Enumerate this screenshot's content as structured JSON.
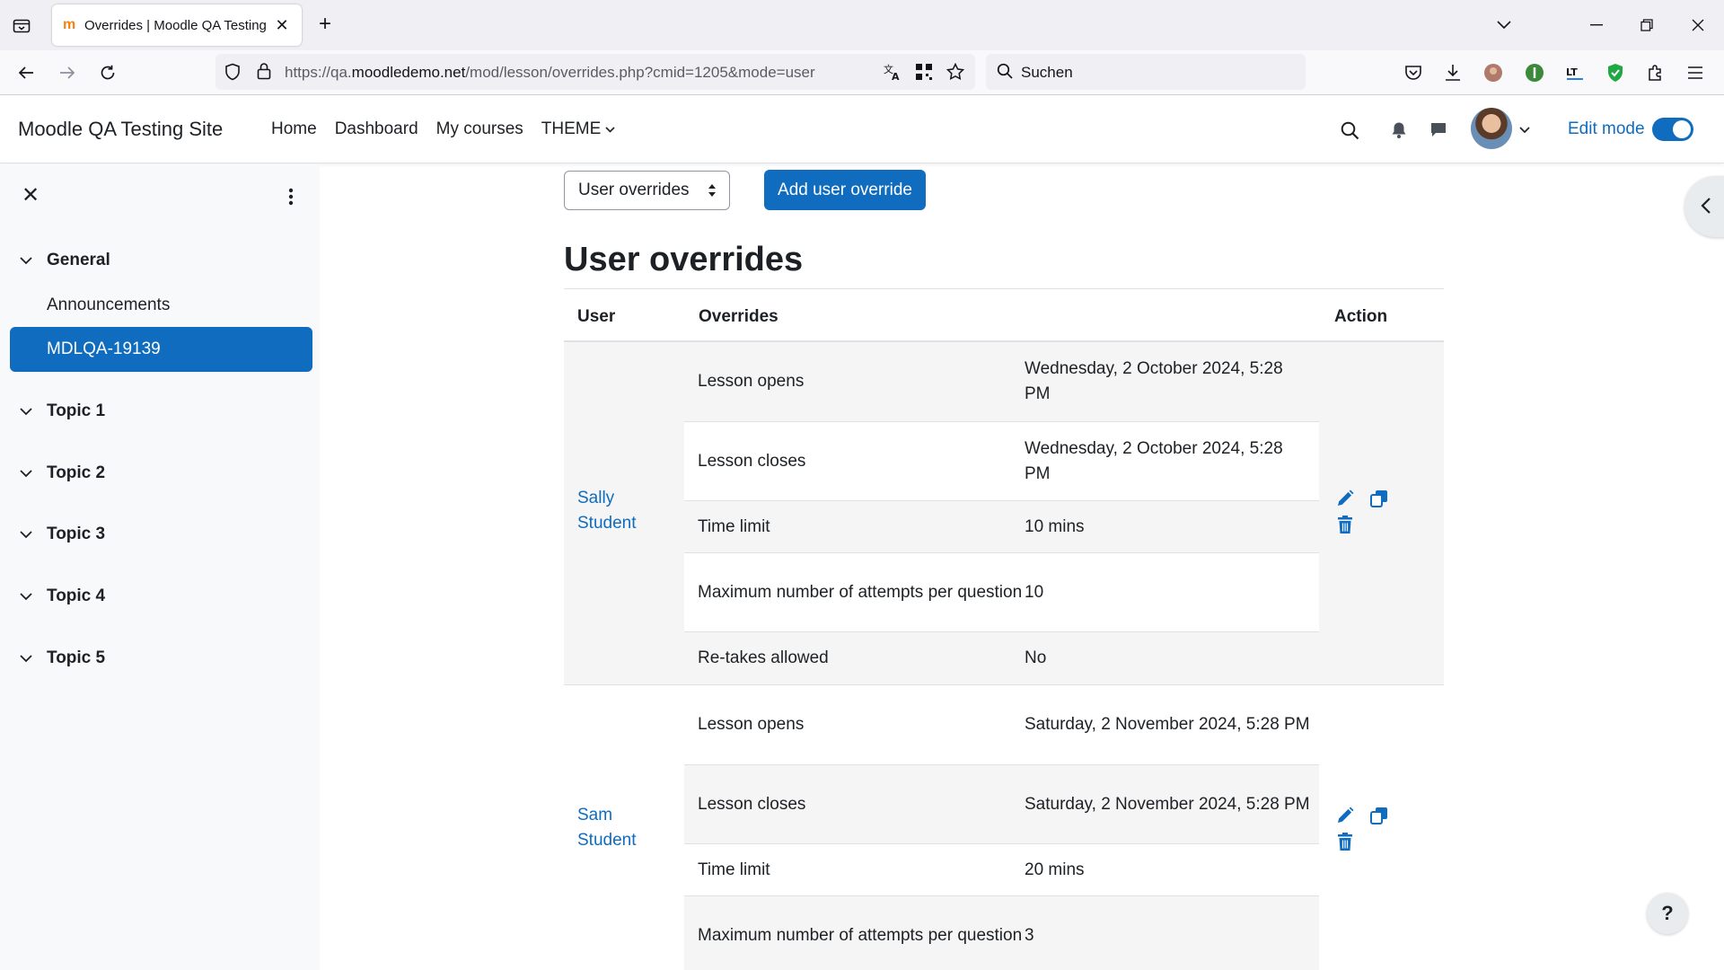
{
  "browser": {
    "tab_title": "Overrides | Moodle QA Testing",
    "url_prefix": "https://qa.",
    "url_domain": "moodledemo.net",
    "url_path": "/mod/lesson/overrides.php?cmid=1205&mode=user",
    "search_placeholder": "Suchen"
  },
  "header": {
    "site_name": "Moodle QA Testing Site",
    "nav": [
      "Home",
      "Dashboard",
      "My courses",
      "THEME"
    ],
    "edit_mode_label": "Edit mode",
    "edit_mode_on": true
  },
  "drawer": {
    "sections": [
      {
        "label": "General"
      },
      {
        "label": "Topic 1"
      },
      {
        "label": "Topic 2"
      },
      {
        "label": "Topic 3"
      },
      {
        "label": "Topic 4"
      },
      {
        "label": "Topic 5"
      }
    ],
    "general_items": [
      "Announcements",
      "MDLQA-19139"
    ]
  },
  "main": {
    "select_value": "User overrides",
    "add_button": "Add user override",
    "heading": "User overrides",
    "columns": {
      "user": "User",
      "overrides": "Overrides",
      "action": "Action"
    },
    "rows": [
      {
        "user": "Sally Student",
        "overrides": [
          {
            "label": "Lesson opens",
            "value": "Wednesday, 2 October 2024, 5:28 PM"
          },
          {
            "label": "Lesson closes",
            "value": "Wednesday, 2 October 2024, 5:28 PM"
          },
          {
            "label": "Time limit",
            "value": "10 mins"
          },
          {
            "label": "Maximum number of attempts per question",
            "value": "10"
          },
          {
            "label": "Re-takes allowed",
            "value": "No"
          }
        ]
      },
      {
        "user": "Sam Student",
        "overrides": [
          {
            "label": "Lesson opens",
            "value": "Saturday, 2 November 2024, 5:28 PM"
          },
          {
            "label": "Lesson closes",
            "value": "Saturday, 2 November 2024, 5:28 PM"
          },
          {
            "label": "Time limit",
            "value": "20 mins"
          },
          {
            "label": "Maximum number of attempts per question",
            "value": "3"
          }
        ]
      }
    ]
  },
  "help_button": "?",
  "colors": {
    "primary": "#0f6cbf",
    "text": "#1d2125",
    "drawer_bg": "#f8f9fa"
  }
}
